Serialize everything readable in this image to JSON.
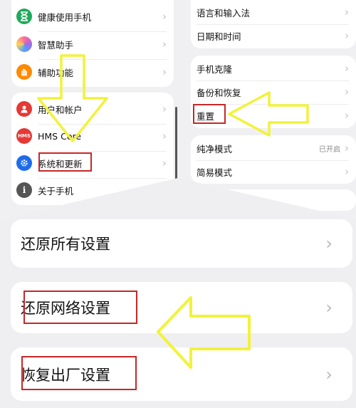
{
  "left_panel": {
    "group1": [
      {
        "label": "健康使用手机",
        "icon": "hourglass-icon",
        "color": "#1faa5c"
      },
      {
        "label": "智慧助手",
        "icon": "assistant-icon",
        "color": "#a06ae8"
      },
      {
        "label": "辅助功能",
        "icon": "hand-icon",
        "color": "#ff8a00"
      }
    ],
    "group2": [
      {
        "label": "用户和帐户",
        "icon": "user-icon",
        "color": "#e53935"
      },
      {
        "label": "HMS Core",
        "icon": "hms-icon",
        "color": "#e53935",
        "glyph": "HMS"
      },
      {
        "label": "系统和更新",
        "icon": "gear-icon",
        "color": "#1e6ce8"
      },
      {
        "label": "关于手机",
        "icon": "info-icon",
        "color": "#555555",
        "glyph": "i"
      }
    ]
  },
  "right_panel": {
    "group1": [
      {
        "label": "语言和输入法"
      },
      {
        "label": "日期和时间"
      }
    ],
    "group2": [
      {
        "label": "手机克隆"
      },
      {
        "label": "备份和恢复"
      },
      {
        "label": "重置"
      }
    ],
    "group3": [
      {
        "label": "纯净模式",
        "value": "已开启"
      },
      {
        "label": "简易模式"
      }
    ]
  },
  "reset_panel": {
    "items": [
      {
        "label": "还原所有设置"
      },
      {
        "label": "还原网络设置"
      },
      {
        "label": "恢复出厂设置"
      }
    ]
  },
  "colors": {
    "arrow": "#f2f23a",
    "highlight": "#c62828"
  }
}
